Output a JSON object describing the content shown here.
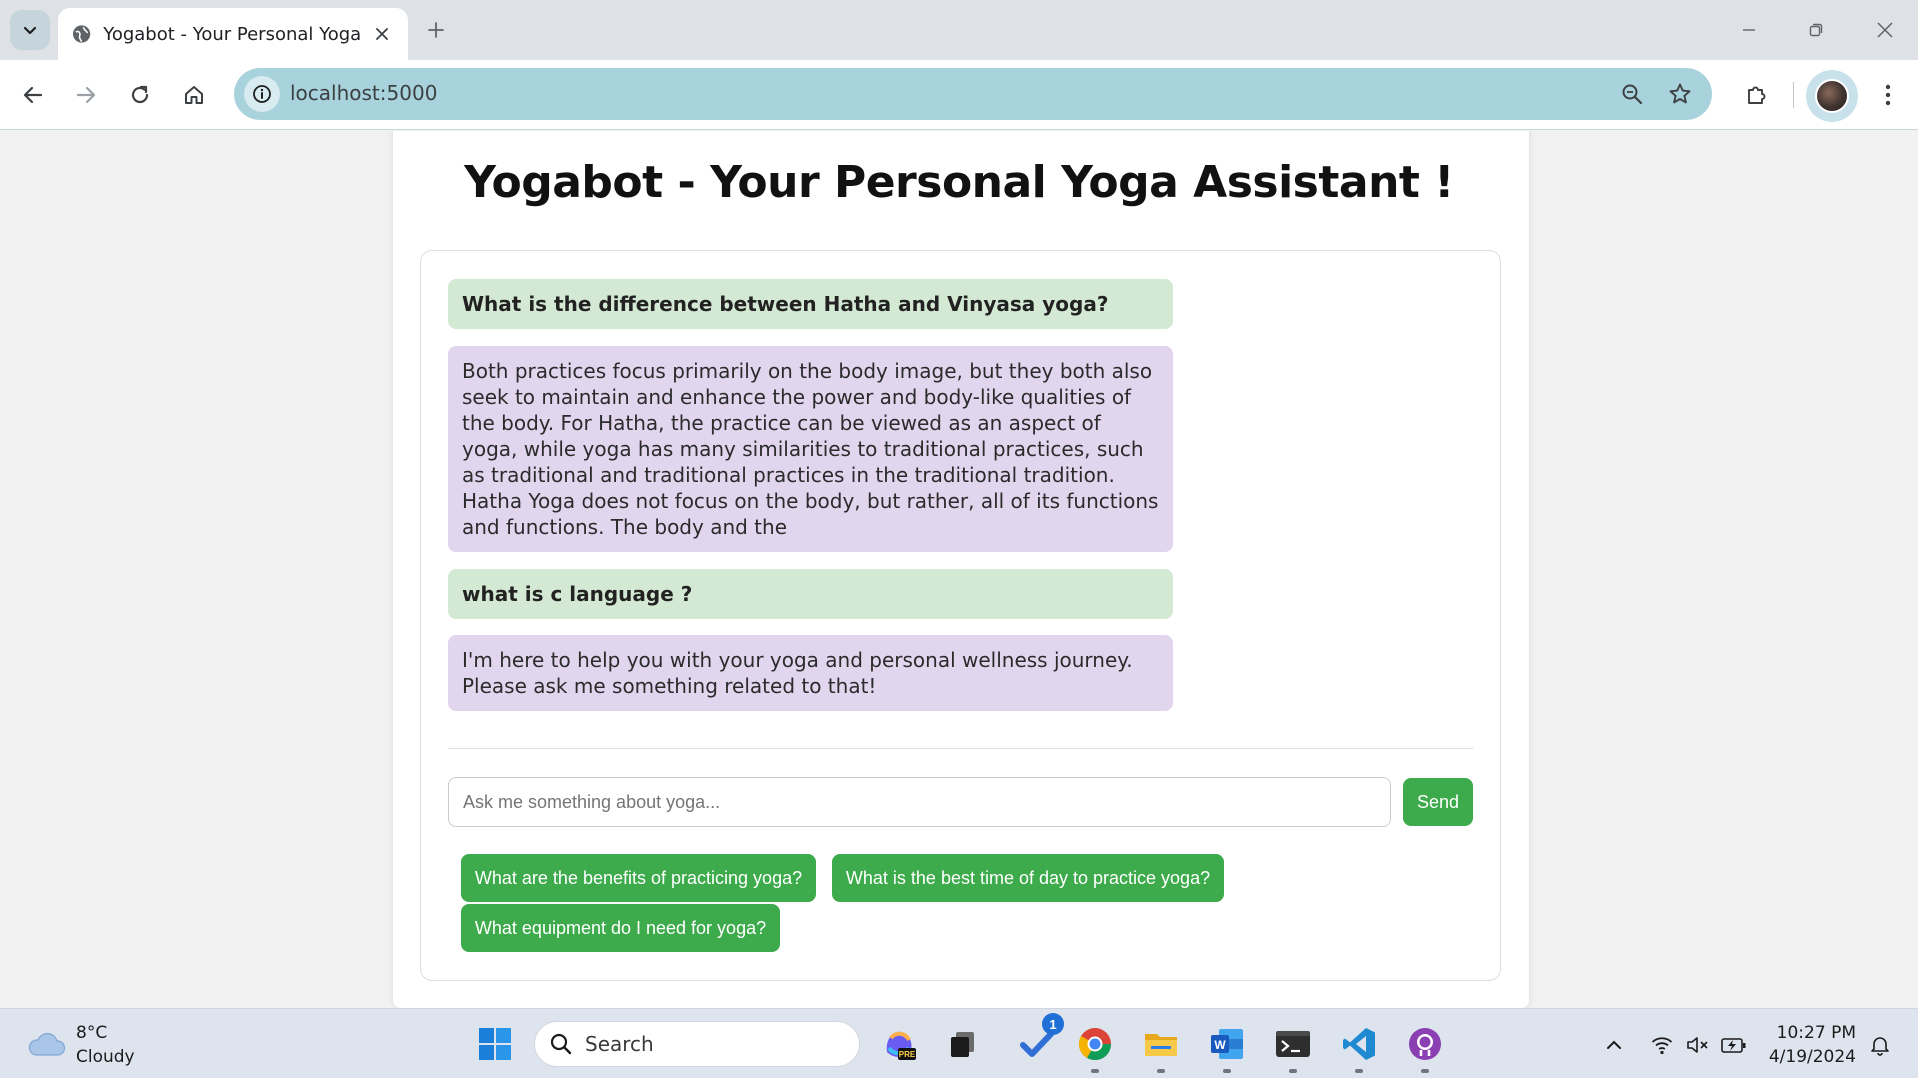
{
  "browser": {
    "tab_title": "Yogabot - Your Personal Yoga Assistant",
    "url": "localhost:5000"
  },
  "page": {
    "title": "Yogabot - Your Personal Yoga Assistant !"
  },
  "chat": {
    "messages": [
      {
        "role": "user",
        "text": "What is the difference between Hatha and Vinyasa yoga?"
      },
      {
        "role": "bot",
        "text": "Both practices focus primarily on the body image, but they both also seek to maintain and enhance the power and body-like qualities of the body. For Hatha, the practice can be viewed as an aspect of yoga, while yoga has many similarities to traditional practices, such as traditional and traditional practices in the traditional tradition. Hatha Yoga does not focus on the body, but rather, all of its functions and functions. The body and the"
      },
      {
        "role": "user",
        "text": "what is c language ?"
      },
      {
        "role": "bot",
        "text": "I'm here to help you with your yoga and personal wellness journey. Please ask me something related to that!"
      }
    ],
    "input_placeholder": "Ask me something about yoga...",
    "input_value": "",
    "send_label": "Send",
    "suggestions": [
      "What are the benefits of practicing yoga?",
      "What is the best time of day to practice yoga?",
      "What equipment do I need for yoga?"
    ]
  },
  "taskbar": {
    "weather_temp": "8°C",
    "weather_desc": "Cloudy",
    "search_label": "Search",
    "todo_badge": "1",
    "time": "10:27 PM",
    "date": "4/19/2024"
  },
  "colors": {
    "accent_green": "#3dab4b",
    "user_bubble": "#d4e9d3",
    "bot_bubble": "#e2d6ef",
    "omnibox": "#a8d2dc"
  }
}
